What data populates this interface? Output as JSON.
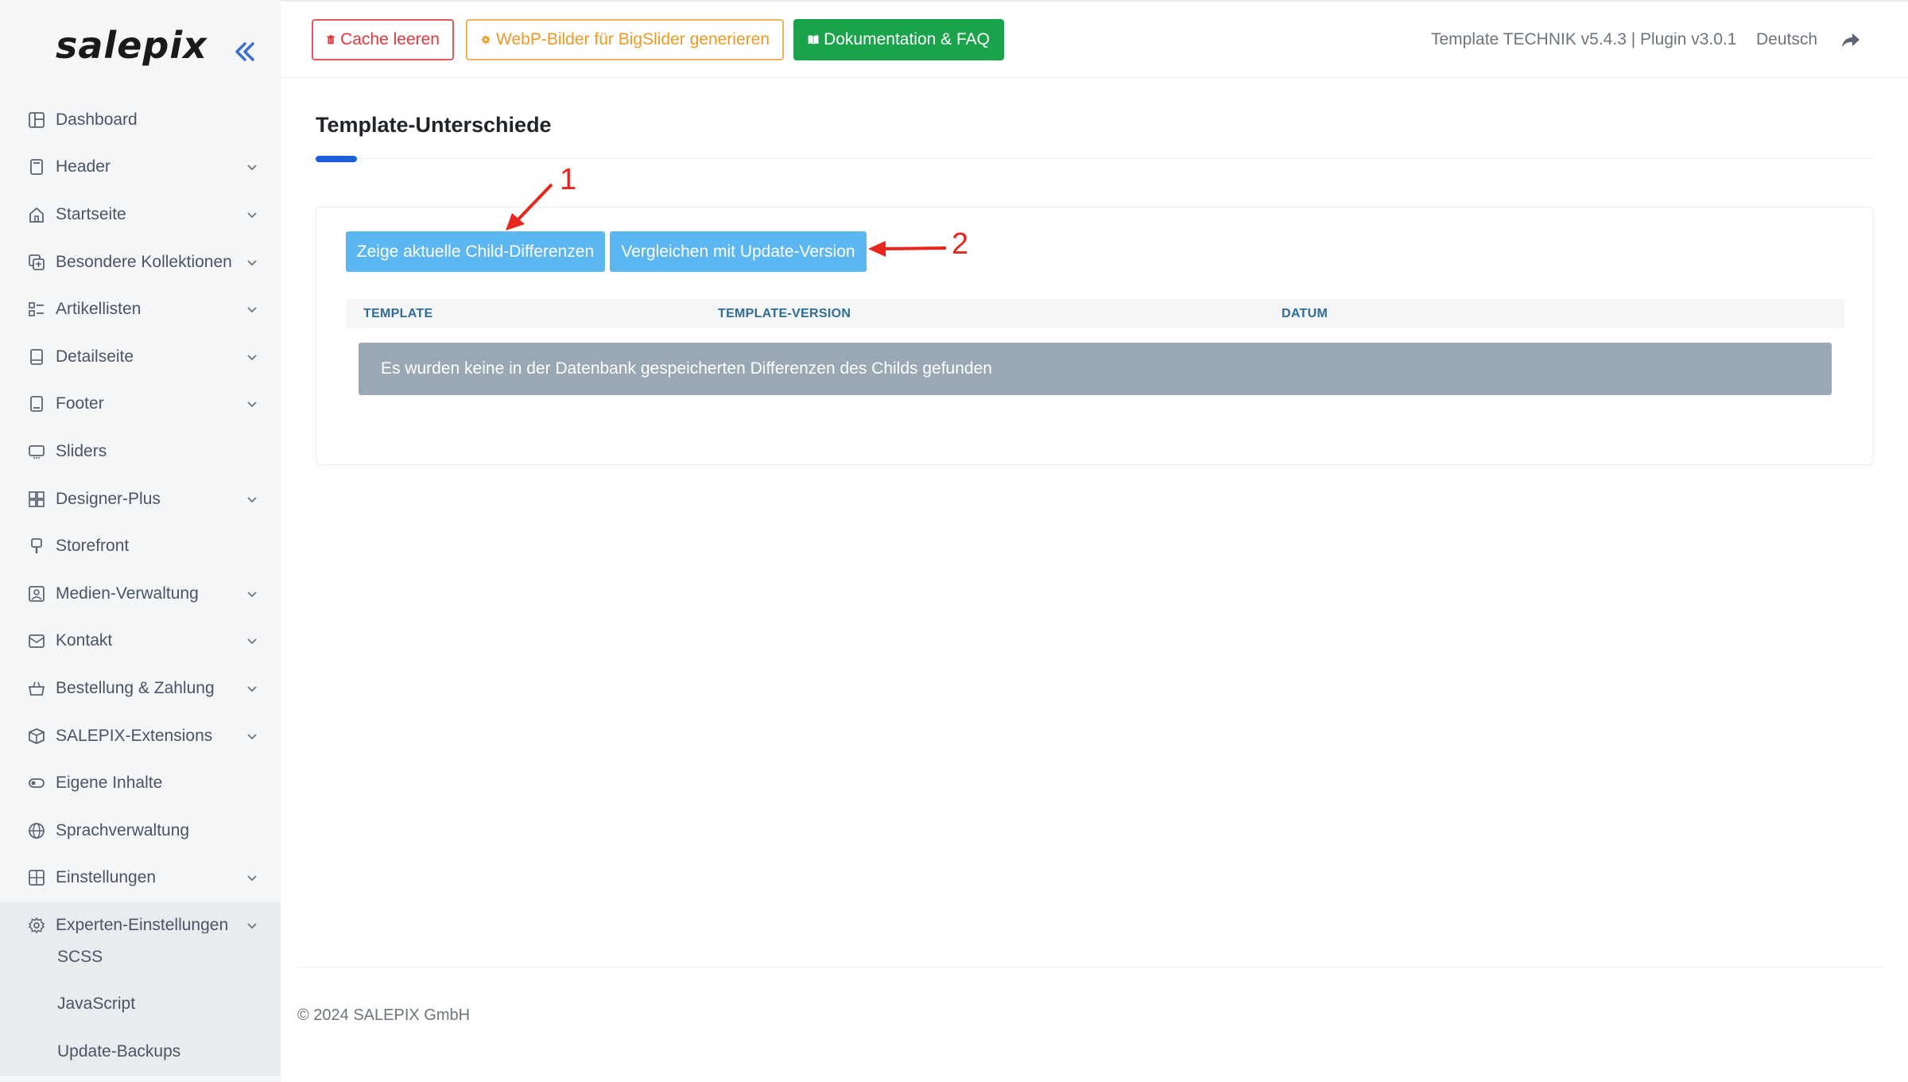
{
  "sidebar": {
    "logo": "salepix",
    "items": [
      {
        "label": "Dashboard",
        "icon": "dashboard-icon",
        "has_children": false
      },
      {
        "label": "Header",
        "icon": "header-icon",
        "has_children": true
      },
      {
        "label": "Startseite",
        "icon": "home-icon",
        "has_children": true
      },
      {
        "label": "Besondere Kollektionen",
        "icon": "collections-icon",
        "has_children": true
      },
      {
        "label": "Artikellisten",
        "icon": "list-icon",
        "has_children": true
      },
      {
        "label": "Detailseite",
        "icon": "detail-icon",
        "has_children": true
      },
      {
        "label": "Footer",
        "icon": "footer-icon",
        "has_children": true
      },
      {
        "label": "Sliders",
        "icon": "slider-icon",
        "has_children": false
      },
      {
        "label": "Designer-Plus",
        "icon": "designer-icon",
        "has_children": true
      },
      {
        "label": "Storefront",
        "icon": "brush-icon",
        "has_children": false
      },
      {
        "label": "Medien-Verwaltung",
        "icon": "media-icon",
        "has_children": true
      },
      {
        "label": "Kontakt",
        "icon": "mail-icon",
        "has_children": true
      },
      {
        "label": "Bestellung & Zahlung",
        "icon": "basket-icon",
        "has_children": true
      },
      {
        "label": "SALEPIX-Extensions",
        "icon": "box-icon",
        "has_children": true
      },
      {
        "label": "Eigene Inhalte",
        "icon": "toggle-icon",
        "has_children": false
      },
      {
        "label": "Sprachverwaltung",
        "icon": "globe-icon",
        "has_children": false
      },
      {
        "label": "Einstellungen",
        "icon": "grid-icon",
        "has_children": true
      },
      {
        "label": "Experten-Einstellungen",
        "icon": "gear-icon",
        "has_children": true,
        "active": true
      }
    ],
    "subitems": [
      "SCSS",
      "JavaScript",
      "Update-Backups"
    ]
  },
  "topbar": {
    "cache_label": "Cache leeren",
    "webp_label": "WebP-Bilder für BigSlider generieren",
    "docs_label": "Dokumentation & FAQ",
    "version": "Template TECHNIK v5.4.3 | Plugin v3.0.1",
    "language": "Deutsch"
  },
  "main": {
    "title": "Template-Unterschiede",
    "btn_child": "Zeige aktuelle Child-Differenzen",
    "btn_compare": "Vergleichen mit Update-Version",
    "columns": [
      "TEMPLATE",
      "TEMPLATE-VERSION",
      "DATUM"
    ],
    "empty_message": "Es wurden keine in der Datenbank gespeicherten Differenzen des Childs gefunden"
  },
  "annotations": {
    "one": "1",
    "two": "2"
  },
  "footer": {
    "copyright": "© 2024 SALEPIX GmbH"
  },
  "colors": {
    "accent": "#1d5fd8",
    "primary_btn": "#5cb6f0",
    "danger": "#e0383b",
    "warning": "#ec9a24",
    "success": "#1aa34a",
    "annotation": "#e8261c"
  }
}
